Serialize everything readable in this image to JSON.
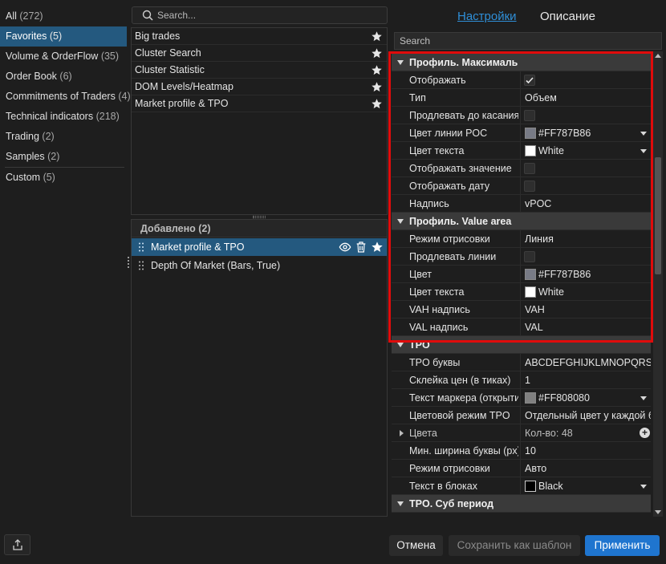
{
  "categories": [
    {
      "label": "All",
      "count": "(272)"
    },
    {
      "label": "Favorites",
      "count": "(5)"
    },
    {
      "label": "Volume & OrderFlow",
      "count": "(35)"
    },
    {
      "label": "Order Book",
      "count": "(6)"
    },
    {
      "label": "Commitments of Traders",
      "count": "(4)"
    },
    {
      "label": "Technical indicators",
      "count": "(218)"
    },
    {
      "label": "Trading",
      "count": "(2)"
    },
    {
      "label": "Samples",
      "count": "(2)"
    },
    {
      "label": "Custom",
      "count": "(5)"
    }
  ],
  "search": {
    "placeholder": "Search..."
  },
  "indicators": [
    {
      "label": "Big trades"
    },
    {
      "label": "Cluster Search"
    },
    {
      "label": "Cluster Statistic"
    },
    {
      "label": "DOM Levels/Heatmap"
    },
    {
      "label": "Market profile & TPO"
    }
  ],
  "added": {
    "header": "Добавлено (2)",
    "items": [
      {
        "label": "Market profile & TPO"
      },
      {
        "label": "Depth Of Market (Bars, True)"
      }
    ]
  },
  "tabs": {
    "settings": "Настройки",
    "description": "Описание"
  },
  "props_search": {
    "placeholder": "Search"
  },
  "props": [
    {
      "label": "Профиль. Максимальный уровень"
    },
    {
      "label": "Отображать",
      "value": ""
    },
    {
      "label": "Тип",
      "value": "Объем"
    },
    {
      "label": "Продлевать до касания",
      "value": ""
    },
    {
      "label": "Цвет линии POC",
      "value": "#FF787B86"
    },
    {
      "label": "Цвет текста",
      "value": "White"
    },
    {
      "label": "Отображать значение",
      "value": ""
    },
    {
      "label": "Отображать дату",
      "value": ""
    },
    {
      "label": "Надпись",
      "value": "vPOC"
    },
    {
      "label": "Профиль. Value area"
    },
    {
      "label": "Режим отрисовки",
      "value": "Линия"
    },
    {
      "label": "Продлевать линии",
      "value": ""
    },
    {
      "label": "Цвет",
      "value": "#FF787B86"
    },
    {
      "label": "Цвет текста",
      "value": "White"
    },
    {
      "label": "VAH надпись",
      "value": "VAH"
    },
    {
      "label": "VAL надпись",
      "value": "VAL"
    },
    {
      "label": "TPO"
    },
    {
      "label": "TPO буквы",
      "value": "ABCDEFGHIJKLMNOPQRSTUVWXYZ"
    },
    {
      "label": "Склейка цен (в тиках)",
      "value": "1"
    },
    {
      "label": "Текст маркера (открытия)",
      "value": "#FF808080"
    },
    {
      "label": "Цветовой режим TPO",
      "value": "Отдельный цвет у каждой буквы"
    },
    {
      "label": "Цвета",
      "value": "Кол-во: 48"
    },
    {
      "label": "Мин. ширина буквы (px)",
      "value": "10"
    },
    {
      "label": "Режим отрисовки",
      "value": "Авто"
    },
    {
      "label": "Текст в блоках",
      "value": "Black"
    },
    {
      "label": "TPO. Суб период"
    }
  ],
  "colors": {
    "accent": "#2f8fd8",
    "selection": "#24597f",
    "apply": "#1f75cf",
    "highlight": "#e00b0b",
    "poc_line": "#787B86",
    "marker_text": "#808080",
    "white_swatch": "#ffffff",
    "black_swatch": "#000000"
  },
  "buttons": {
    "cancel": "Отмена",
    "save_template": "Сохранить как шаблон",
    "apply": "Применить"
  }
}
